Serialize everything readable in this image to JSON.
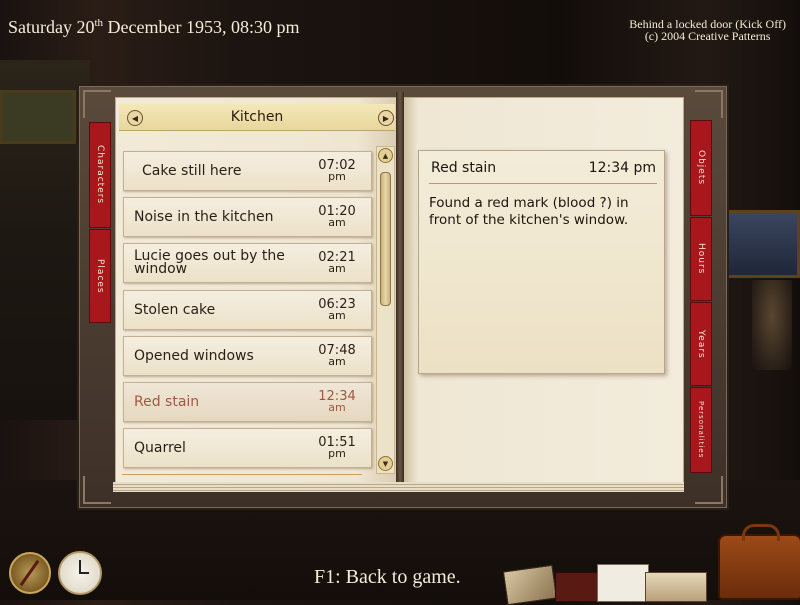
{
  "header": {
    "date_text": "Saturday 20",
    "date_sup": "th",
    "date_rest": " December 1953, 08:30 pm",
    "title_line1": "Behind a locked door (Kick Off)",
    "title_line2": "(c) 2004 Creative Patterns"
  },
  "left_tabs": [
    "Characters",
    "Places"
  ],
  "right_tabs": [
    "Objets",
    "Hours",
    "Years",
    "Personalities"
  ],
  "location": {
    "name": "Kitchen",
    "prev_icon": "triangle-left-icon",
    "next_icon": "triangle-right-icon"
  },
  "entries": [
    {
      "label": "Cake still here",
      "time": "07:02",
      "ampm": "pm"
    },
    {
      "label": "Noise in the kitchen",
      "time": "01:20",
      "ampm": "am"
    },
    {
      "label": "Lucie goes out by the window",
      "time": "02:21",
      "ampm": "am"
    },
    {
      "label": "Stolen cake",
      "time": "06:23",
      "ampm": "am"
    },
    {
      "label": "Opened windows",
      "time": "07:48",
      "ampm": "am"
    },
    {
      "label": "Red stain",
      "time": "12:34",
      "ampm": "am",
      "selected": true
    },
    {
      "label": "Quarrel",
      "time": "01:51",
      "ampm": "pm"
    }
  ],
  "note": {
    "title": "Red stain",
    "time": "12:34 pm",
    "body": "Found a red mark (blood ?) in front of the kitchen's window."
  },
  "footer": {
    "hint": "F1: Back to game."
  },
  "colors": {
    "tab_red": "#a8171b",
    "selected_text": "#9c5a44",
    "page": "#f2ead8"
  }
}
